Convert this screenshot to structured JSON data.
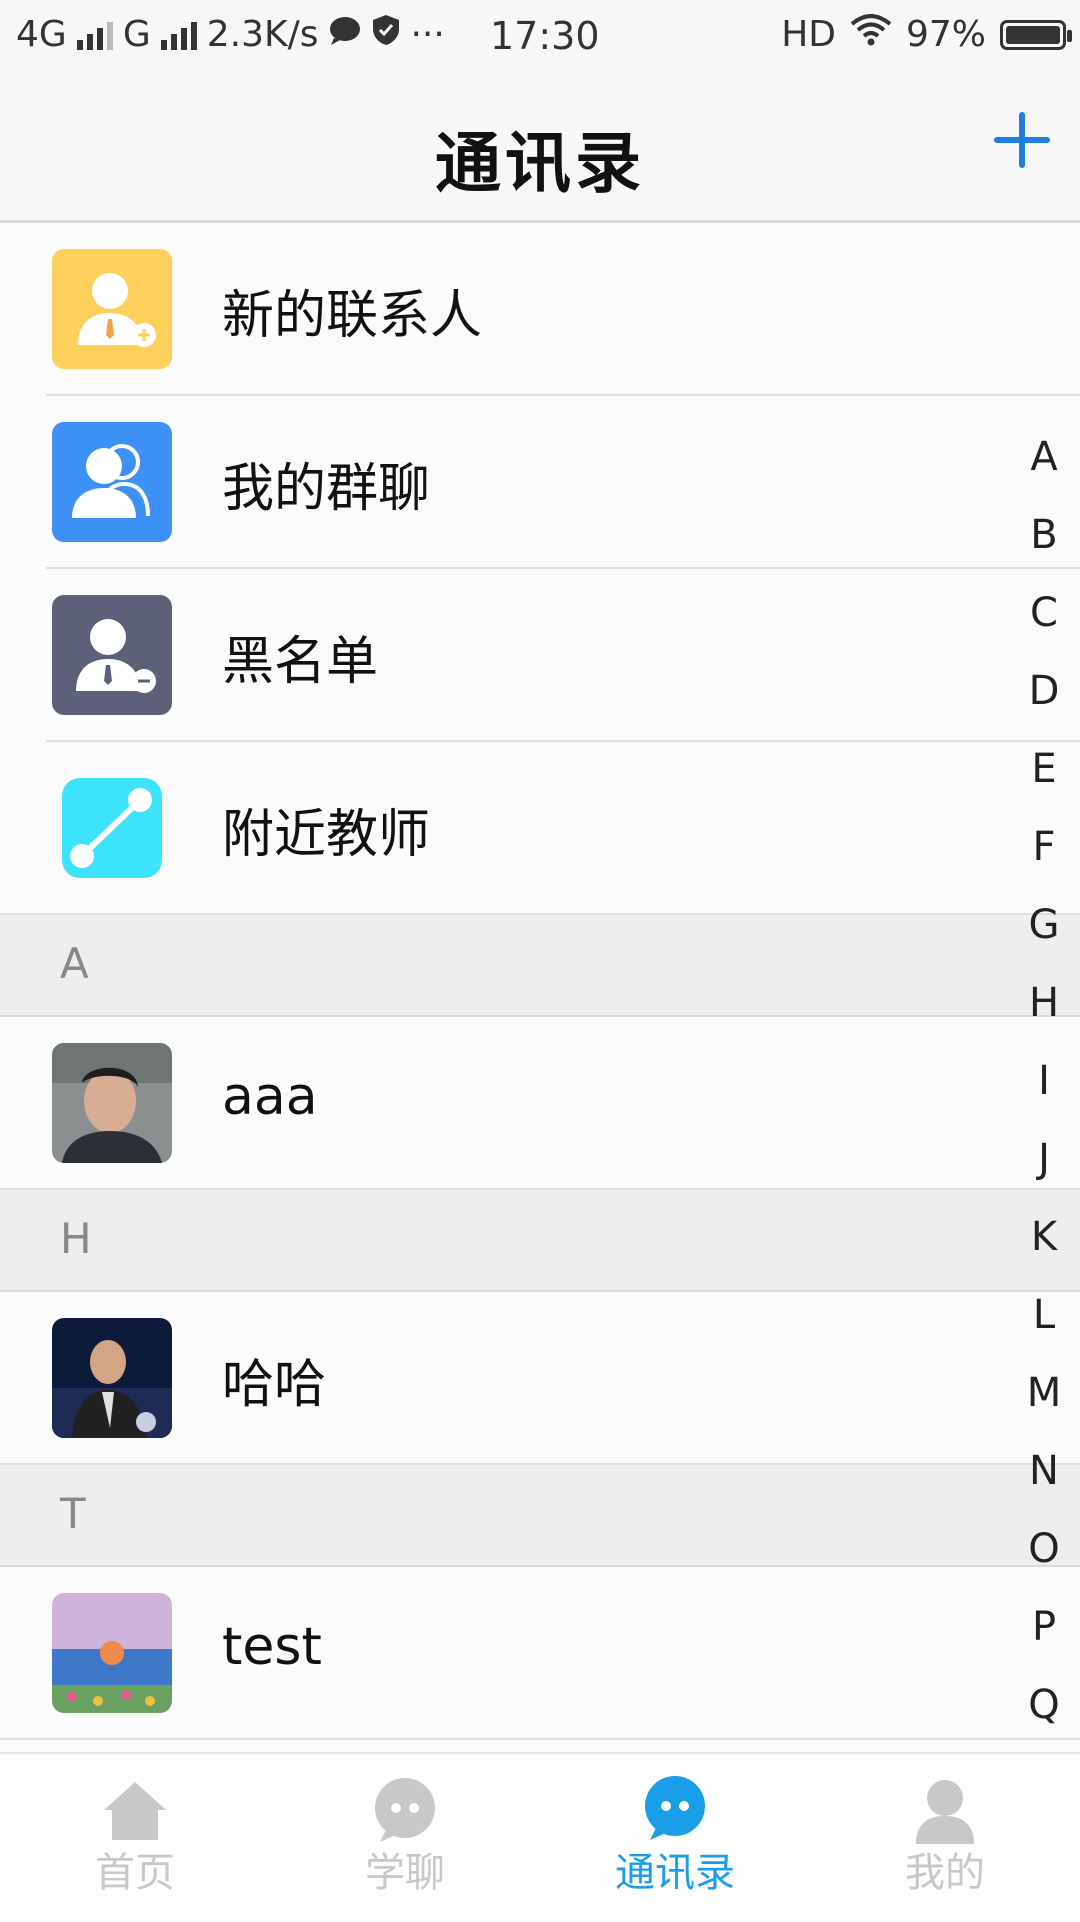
{
  "status_bar": {
    "network1": "4G",
    "network2": "G",
    "speed": "2.3K/s",
    "dots": "···",
    "time": "17:30",
    "hd": "HD",
    "battery": "97%"
  },
  "header": {
    "title": "通讯录"
  },
  "special_items": [
    {
      "label": "新的联系人",
      "icon": "add-contact-icon",
      "color": "#fcd05a"
    },
    {
      "label": "我的群聊",
      "icon": "group-chat-icon",
      "color": "#3d90f4"
    },
    {
      "label": "黑名单",
      "icon": "blacklist-icon",
      "color": "#5d6079"
    },
    {
      "label": "附近教师",
      "icon": "nearby-teachers-icon",
      "color": "#3de2fb"
    }
  ],
  "sections": [
    {
      "letter": "A",
      "contacts": [
        {
          "name": "aaa"
        }
      ]
    },
    {
      "letter": "H",
      "contacts": [
        {
          "name": "哈哈"
        }
      ]
    },
    {
      "letter": "T",
      "contacts": [
        {
          "name": "test"
        }
      ]
    }
  ],
  "index_letters": [
    "A",
    "B",
    "C",
    "D",
    "E",
    "F",
    "G",
    "H",
    "I",
    "J",
    "K",
    "L",
    "M",
    "N",
    "O",
    "P",
    "Q"
  ],
  "tabbar": {
    "items": [
      {
        "label": "首页",
        "icon": "home-icon"
      },
      {
        "label": "学聊",
        "icon": "chat-bubble-icon"
      },
      {
        "label": "通讯录",
        "icon": "contacts-bubble-icon",
        "active": true
      },
      {
        "label": "我的",
        "icon": "person-icon"
      }
    ],
    "active_color": "#1a9ee8",
    "inactive_color": "#c8c8c8"
  }
}
